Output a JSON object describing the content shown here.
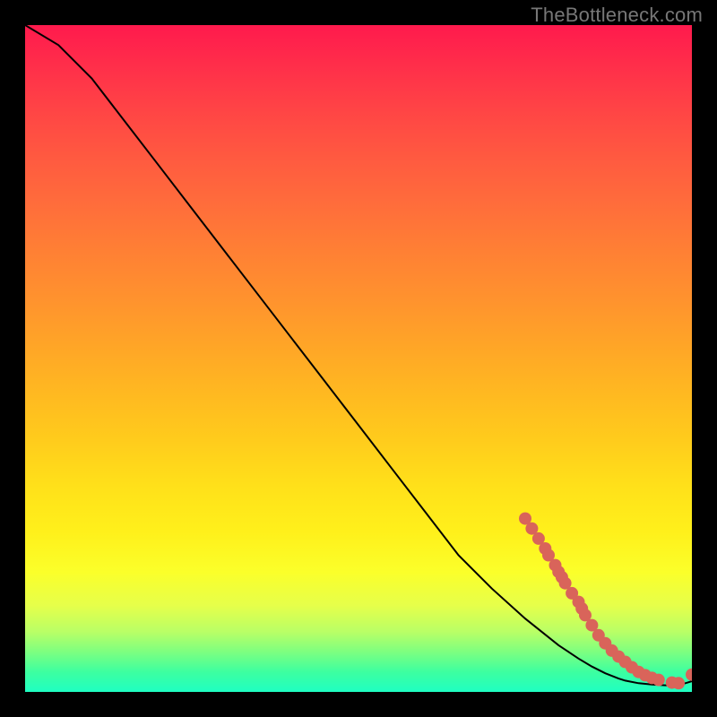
{
  "watermark": {
    "text": "TheBottleneck.com"
  },
  "colors": {
    "marker_fill": "#d9645a",
    "curve_stroke": "#000000",
    "frame": "#000000"
  },
  "chart_data": {
    "type": "line",
    "title": "",
    "xlabel": "",
    "ylabel": "",
    "xlim": [
      0,
      100
    ],
    "ylim": [
      0,
      100
    ],
    "grid": false,
    "legend": false,
    "series": [
      {
        "name": "curve",
        "style": "line",
        "x": [
          0,
          5,
          10,
          15,
          20,
          25,
          30,
          35,
          40,
          45,
          50,
          55,
          60,
          65,
          70,
          75,
          80,
          83,
          85,
          87,
          89,
          90,
          92,
          94,
          96,
          98,
          100
        ],
        "y": [
          100,
          97,
          92,
          85.5,
          79,
          72.5,
          66,
          59.5,
          53,
          46.5,
          40,
          33.5,
          27,
          20.5,
          15.5,
          11,
          7,
          5,
          3.8,
          2.8,
          2.0,
          1.7,
          1.3,
          1.1,
          1.0,
          1.0,
          1.6
        ]
      },
      {
        "name": "markers",
        "style": "scatter",
        "x": [
          75,
          76,
          77,
          78,
          78.5,
          79.5,
          80,
          80.5,
          81,
          82,
          83,
          83.5,
          84,
          85,
          86,
          87,
          88,
          89,
          90,
          91,
          92,
          93,
          94,
          95,
          97,
          98,
          100
        ],
        "y": [
          26,
          24.5,
          23,
          21.5,
          20.5,
          19,
          18,
          17.2,
          16.3,
          14.8,
          13.5,
          12.5,
          11.5,
          10,
          8.5,
          7.3,
          6.2,
          5.3,
          4.5,
          3.7,
          3.0,
          2.5,
          2.1,
          1.8,
          1.4,
          1.3,
          2.6
        ]
      }
    ]
  }
}
